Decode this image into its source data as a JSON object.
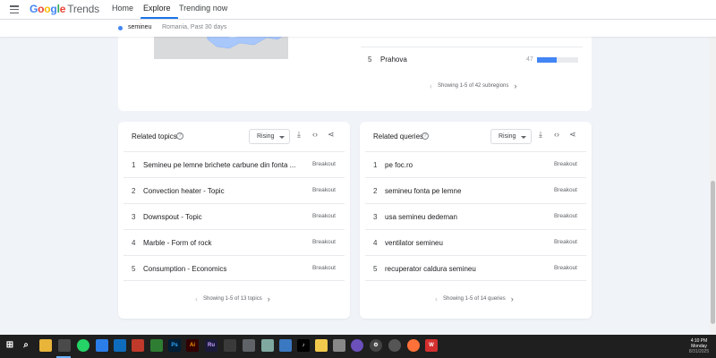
{
  "header": {
    "logo_google": "Google",
    "logo_trends": "Trends",
    "nav": [
      {
        "label": "Home"
      },
      {
        "label": "Explore"
      },
      {
        "label": "Trending now"
      }
    ]
  },
  "subheader": {
    "term": "semineu",
    "meta": "Romania, Past 30 days"
  },
  "region": {
    "row": {
      "rank": "5",
      "name": "Prahova",
      "value": "47",
      "fill_fraction": 0.47
    },
    "pager": "Showing 1-5 of 42 subregions"
  },
  "related_topics": {
    "title": "Related topics",
    "filter": "Rising",
    "items": [
      {
        "rank": "1",
        "label": "Semineu pe lemne brichete carbune din fonta ...",
        "value": "Breakout"
      },
      {
        "rank": "2",
        "label": "Convection heater - Topic",
        "value": "Breakout"
      },
      {
        "rank": "3",
        "label": "Downspout - Topic",
        "value": "Breakout"
      },
      {
        "rank": "4",
        "label": "Marble - Form of rock",
        "value": "Breakout"
      },
      {
        "rank": "5",
        "label": "Consumption - Economics",
        "value": "Breakout"
      }
    ],
    "pager": "Showing 1-5 of 13 topics"
  },
  "related_queries": {
    "title": "Related queries",
    "filter": "Rising",
    "items": [
      {
        "rank": "1",
        "label": "pe foc.ro",
        "value": "Breakout"
      },
      {
        "rank": "2",
        "label": "semineu fonta pe lemne",
        "value": "Breakout"
      },
      {
        "rank": "3",
        "label": "usa semineu dedeman",
        "value": "Breakout"
      },
      {
        "rank": "4",
        "label": "ventilator semineu",
        "value": "Breakout"
      },
      {
        "rank": "5",
        "label": "recuperator caldura semineu",
        "value": "Breakout"
      }
    ],
    "pager": "Showing 1-5 of 14 queries"
  },
  "taskbar": {
    "clock_time": "4:10 PM",
    "clock_day": "Monday",
    "clock_date": "8/31/2025"
  },
  "colors": {
    "accent": "#1a73e8",
    "series_blue": "#4285f4",
    "background": "#f0f3f8"
  }
}
